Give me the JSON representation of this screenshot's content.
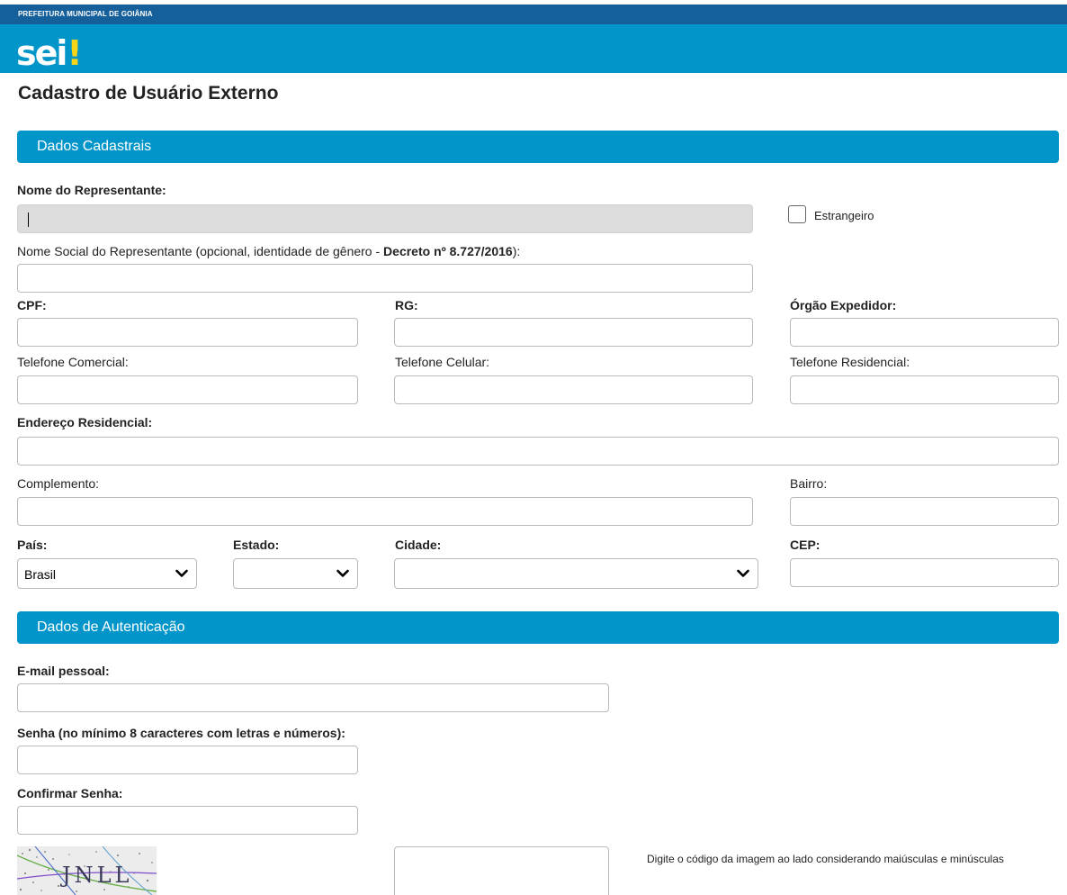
{
  "header": {
    "org_name": "PREFEITURA MUNICIPAL DE GOIÂNIA",
    "logo_text": "sei",
    "logo_mark": "!",
    "colors": {
      "top_bar": "#155f9b",
      "brand_bar": "#0195c9",
      "logo_mark": "#f6d418"
    }
  },
  "page_title": "Cadastro de Usuário Externo",
  "sections": {
    "registration": "Dados Cadastrais",
    "authentication": "Dados de Autenticação"
  },
  "fields": {
    "representative_name": {
      "label": "Nome do Representante:",
      "value": ""
    },
    "foreigner": {
      "label": "Estrangeiro",
      "checked": false
    },
    "social_name": {
      "label_prefix": "Nome Social do Representante (opcional, identidade de gênero - ",
      "label_bold": "Decreto nº 8.727/2016",
      "label_suffix": "):",
      "value": ""
    },
    "cpf": {
      "label": "CPF:",
      "value": ""
    },
    "rg": {
      "label": "RG:",
      "value": ""
    },
    "issuing_agency": {
      "label": "Órgão Expedidor:",
      "value": ""
    },
    "business_phone": {
      "label": "Telefone Comercial:",
      "value": ""
    },
    "mobile_phone": {
      "label": "Telefone Celular:",
      "value": ""
    },
    "home_phone": {
      "label": "Telefone Residencial:",
      "value": ""
    },
    "home_address": {
      "label": "Endereço Residencial:",
      "value": ""
    },
    "complement": {
      "label": "Complemento:",
      "value": ""
    },
    "neighborhood": {
      "label": "Bairro:",
      "value": ""
    },
    "country": {
      "label": "País:",
      "value": "Brasil"
    },
    "state": {
      "label": "Estado:",
      "value": ""
    },
    "city": {
      "label": "Cidade:",
      "value": ""
    },
    "zip": {
      "label": "CEP:",
      "value": ""
    },
    "email": {
      "label": "E-mail pessoal:",
      "value": ""
    },
    "password": {
      "label": "Senha (no mínimo 8 caracteres com letras e números):",
      "value": ""
    },
    "confirm_password": {
      "label": "Confirmar Senha:",
      "value": ""
    },
    "captcha": {
      "image_text": "JNLL",
      "value": "",
      "help": "Digite o código da imagem ao lado considerando maiúsculas e minúsculas"
    }
  },
  "icons": {
    "select_arrow": "chevron-down-icon"
  }
}
